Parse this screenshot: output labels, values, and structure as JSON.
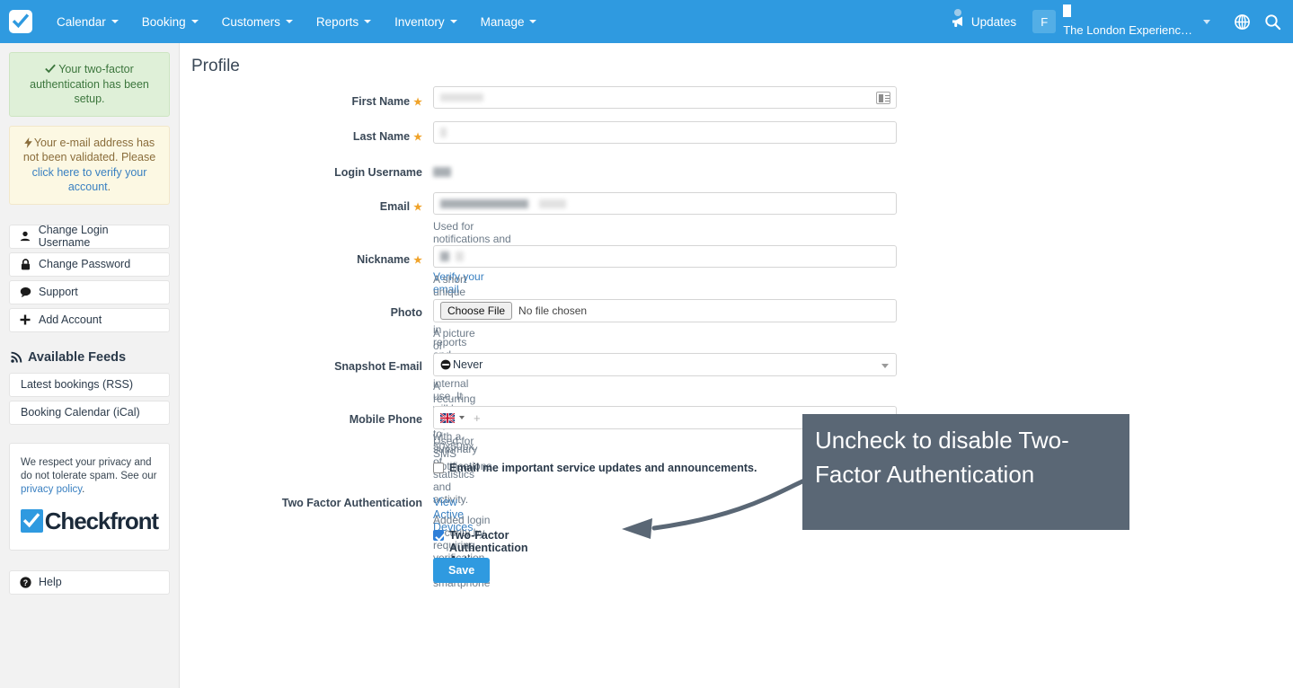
{
  "topnav": {
    "logo_name": "checkfront-logo",
    "menus": [
      {
        "label": "Calendar"
      },
      {
        "label": "Booking"
      },
      {
        "label": "Customers"
      },
      {
        "label": "Reports"
      },
      {
        "label": "Inventory"
      },
      {
        "label": "Manage"
      }
    ],
    "updates_label": "Updates",
    "avatar_initial": "F",
    "account_name": "The London Experienc…",
    "globe_icon": "globe-icon",
    "search_icon": "search-icon",
    "brand_color": "#2f9ae0"
  },
  "sidebar": {
    "alert_success": "Your two-factor authentication has been setup.",
    "alert_warning_pre": "Your e-mail address has not been validated. Please ",
    "alert_warning_link": "click here to verify your account",
    "alert_warning_post": ".",
    "buttons": [
      {
        "label": "Change Login Username",
        "icon": "user-icon"
      },
      {
        "label": "Change Password",
        "icon": "lock-icon"
      },
      {
        "label": "Support",
        "icon": "comment-icon"
      },
      {
        "label": "Add Account",
        "icon": "plus-icon"
      }
    ],
    "feeds_heading": "Available Feeds",
    "feeds": [
      {
        "label": "Latest bookings (RSS)"
      },
      {
        "label": "Booking Calendar (iCal)"
      }
    ],
    "privacy_text_1": "We respect your privacy and do not tolerate spam. See our ",
    "privacy_link": "privacy policy",
    "privacy_text_2": ".",
    "brand_word": "Checkfront",
    "help_label": "Help"
  },
  "main": {
    "page_title": "Profile",
    "fields": {
      "first_name": {
        "label": "First Name",
        "required": true,
        "value": "",
        "icon": "contact-card-icon"
      },
      "last_name": {
        "label": "Last Name",
        "required": true,
        "value": ""
      },
      "login_username": {
        "label": "Login Username",
        "required": false,
        "value": ""
      },
      "email": {
        "label": "Email",
        "required": true,
        "value": "",
        "hint_pre": "Used for notifications and internal communications. ",
        "hint_link": "Verify your email",
        "hint_post": "."
      },
      "nickname": {
        "label": "Nickname",
        "required": true,
        "value": "",
        "hint": "A short unique name used in reports and notes."
      },
      "photo": {
        "label": "Photo",
        "button_label": "Choose File",
        "no_file_label": "No file chosen",
        "hint": "A picture of yourself for internal use. It will be resized to 50x50px."
      },
      "snapshot_email": {
        "label": "Snapshot E-mail",
        "selected": "Never",
        "options": [
          "Never"
        ],
        "hint": "A recurring email report with a summary of statistics and activity."
      },
      "mobile_phone": {
        "label": "Mobile Phone",
        "country_flag": "uk-flag-icon",
        "placeholder": "+",
        "hint": "Used for SMS Notifications"
      },
      "updates_checkbox": {
        "label": "Email me important service updates and announcements.",
        "checked": false
      },
      "two_factor": {
        "label": "Two Factor Authentication",
        "link": "View Active Devices",
        "hint": "Added login security by requiring verification from your smartphone",
        "checkbox_label": "Two-Factor Authentication Active.",
        "checked": true
      }
    },
    "save_label": "Save"
  },
  "annotation": {
    "text": "Uncheck to disable Two-Factor Authentication",
    "bg_color": "#5a6775",
    "arrow_name": "curved-arrow-pointer"
  }
}
